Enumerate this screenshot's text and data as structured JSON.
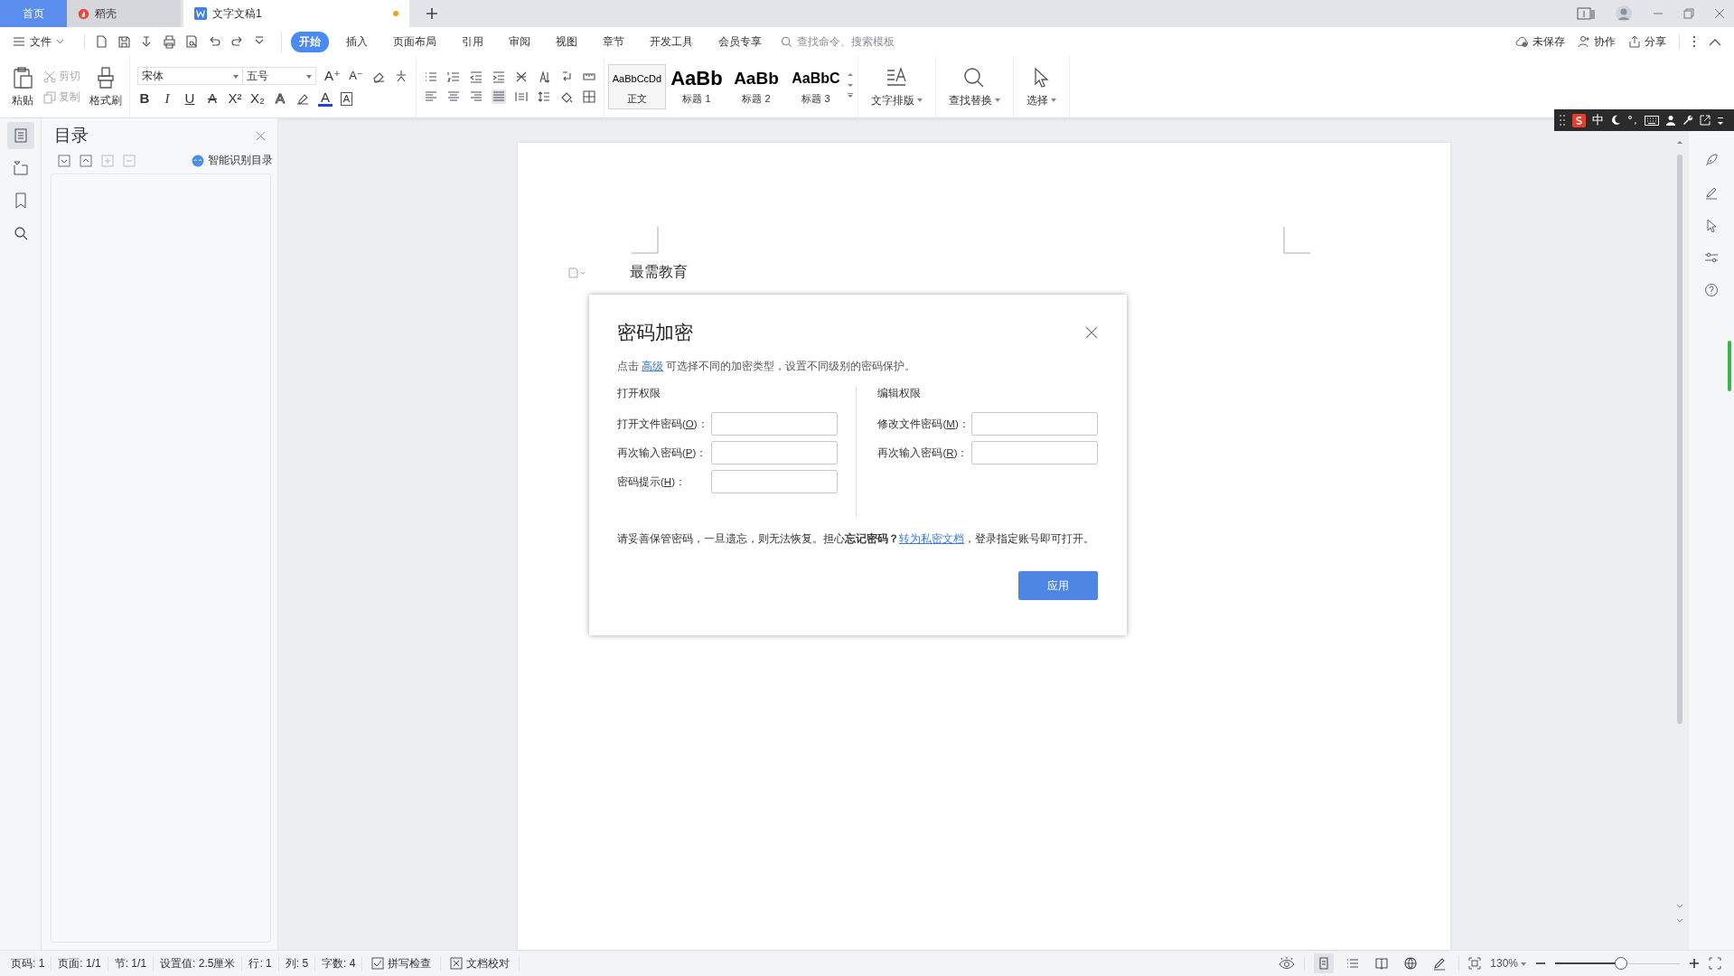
{
  "tabs": [
    {
      "kind": "home",
      "label": "首页",
      "selected": false
    },
    {
      "kind": "app",
      "label": "稻壳",
      "selected": false
    },
    {
      "kind": "doc",
      "label": "文字文稿1",
      "selected": true,
      "unsaved": true
    }
  ],
  "menu": {
    "file": "文件",
    "ribbon_tabs": [
      {
        "label": "开始",
        "selected": true
      },
      {
        "label": "插入",
        "selected": false
      },
      {
        "label": "页面布局",
        "selected": false
      },
      {
        "label": "引用",
        "selected": false
      },
      {
        "label": "审阅",
        "selected": false
      },
      {
        "label": "视图",
        "selected": false
      },
      {
        "label": "章节",
        "selected": false
      },
      {
        "label": "开发工具",
        "selected": false
      },
      {
        "label": "会员专享",
        "selected": false
      }
    ],
    "search": {
      "placeholder": "查找命令、搜索模板"
    },
    "actions": [
      {
        "kind": "cloud",
        "label": "未保存"
      },
      {
        "kind": "people",
        "label": "协作"
      },
      {
        "kind": "share",
        "label": "分享"
      }
    ]
  },
  "ribbon": {
    "paste": "粘贴",
    "cut": {
      "label": "剪切",
      "disabled": true
    },
    "copy": {
      "label": "复制",
      "disabled": true
    },
    "format_painter": "格式刷",
    "font": "宋体",
    "font_size": "五号",
    "size_buttons": [
      {
        "kind": "grow",
        "glyph": "A⁺"
      },
      {
        "kind": "shrink",
        "glyph": "A⁻"
      }
    ],
    "font_buttons": [
      {
        "kind": "bold",
        "glyph": "B"
      },
      {
        "kind": "italic",
        "glyph": "I"
      },
      {
        "kind": "underline",
        "glyph": "U"
      },
      {
        "kind": "strike",
        "glyph": "A"
      },
      {
        "kind": "sup",
        "glyph": "X²"
      },
      {
        "kind": "sub",
        "glyph": "X₂"
      },
      {
        "kind": "effect",
        "glyph": "A"
      },
      {
        "kind": "highlight"
      },
      {
        "kind": "color",
        "glyph": "A"
      },
      {
        "kind": "boxed",
        "glyph": "A"
      }
    ],
    "styles": [
      {
        "preview": "AaBbCcDd",
        "label": "正文",
        "selected": true
      },
      {
        "preview": "AaBb",
        "label": "标题 1",
        "selected": false
      },
      {
        "preview": "AaBb",
        "label": "标题 2",
        "selected": false
      },
      {
        "preview": "AaBbC",
        "label": "标题 3",
        "selected": false
      }
    ],
    "tools": [
      {
        "kind": "layout",
        "label": "文字排版"
      },
      {
        "kind": "find",
        "label": "查找替换"
      },
      {
        "kind": "select",
        "label": "选择"
      }
    ]
  },
  "ime": {
    "mode": "中"
  },
  "sidebar": {
    "title": "目录",
    "smart_button": "智能识别目录"
  },
  "document": {
    "text": "最需教育"
  },
  "dialog": {
    "title": "密码加密",
    "intro": {
      "before": "点击",
      "link": "高级",
      "after": "可选择不同的加密类型，设置不同级别的密码保护。"
    },
    "sections": [
      {
        "heading": "打开权限",
        "fields": [
          {
            "prefix": "打开文件密码(",
            "key": "O",
            "suffix": ")："
          },
          {
            "prefix": "再次输入密码(",
            "key": "P",
            "suffix": ")："
          },
          {
            "prefix": "密码提示(",
            "key": "H",
            "suffix": ")："
          }
        ]
      },
      {
        "heading": "编辑权限",
        "fields": [
          {
            "prefix": "修改文件密码(",
            "key": "M",
            "suffix": ")："
          },
          {
            "prefix": "再次输入密码(",
            "key": "R",
            "suffix": ")："
          }
        ]
      }
    ],
    "note": {
      "text": "请妥善保管密码，一旦遗忘，则无法恢复。担心**忘记密码？**",
      "link": "转为私密文档",
      "after": "，登录指定账号即可打开。"
    },
    "apply": "应用"
  },
  "status_bar": {
    "items": [
      "页码: 1",
      "页面: 1/1",
      "节: 1/1",
      "设置值: 2.5厘米",
      "行: 1",
      "列: 5",
      "字数: 4"
    ],
    "checks": [
      {
        "kind": "spell",
        "label": "拼写检查"
      },
      {
        "kind": "proof",
        "label": "文档校对"
      }
    ],
    "views": [
      {
        "kind": "page",
        "selected": true
      },
      {
        "kind": "outline",
        "selected": false
      },
      {
        "kind": "read",
        "selected": false
      },
      {
        "kind": "web",
        "selected": false
      },
      {
        "kind": "write",
        "selected": false
      }
    ],
    "zoom": "130%",
    "zoom_slider": {
      "level": 0.53
    }
  }
}
